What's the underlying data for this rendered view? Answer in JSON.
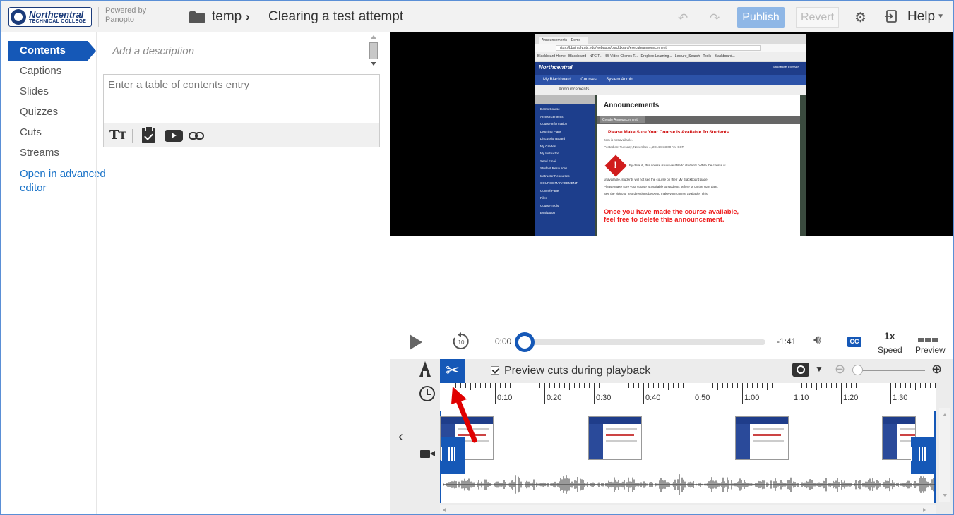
{
  "header": {
    "logo_name": "Northcentral",
    "logo_sub": "TECHNICAL COLLEGE",
    "powered_by": "Powered by Panopto",
    "breadcrumb_folder": "temp",
    "breadcrumb_title": "Clearing a test attempt",
    "publish_label": "Publish",
    "revert_label": "Revert",
    "help_label": "Help"
  },
  "sidebar": {
    "items": [
      {
        "label": "Contents",
        "active": true
      },
      {
        "label": "Captions"
      },
      {
        "label": "Slides"
      },
      {
        "label": "Quizzes"
      },
      {
        "label": "Cuts"
      },
      {
        "label": "Streams"
      }
    ],
    "advanced_link": "Open in advanced editor"
  },
  "contents": {
    "description_placeholder": "Add a description",
    "toc_placeholder": "Enter a table of contents entry",
    "toolbar_icons": [
      "text-format-icon",
      "quiz-icon",
      "youtube-icon",
      "link-icon"
    ]
  },
  "video_frame": {
    "tab_title": "Announcements – Demo",
    "url": "https://bbsimply.ntc.edu/webapps/blackboard/execute/announcement",
    "bookmarks": "Blackboard Home · Blackboard - NTC T... · 55 Video Clienes T... · Dropbox Learning... · Lecture_Search · Tools - Blackboard...",
    "brand": "Northcentral",
    "user": "Jonathan Dufner",
    "nav": [
      "My Blackboard",
      "Courses",
      "System Admin"
    ],
    "breadcrumb": "Announcements",
    "side_items": [
      "Demo Course",
      "Announcements",
      "Course Information",
      "Learning Plans",
      "Discussion Board",
      "My Grades",
      "My Instructor",
      "Send Email",
      "Student Resources",
      "Instructor Resources",
      "COURSE MANAGEMENT",
      "Control Panel",
      "Files",
      "Course Tools",
      "Evaluation"
    ],
    "heading": "Announcements",
    "create_btn": "Create Announcement",
    "msg_title": "Please Make Sure Your Course is Available To Students",
    "msg_line1": "Item is not available.",
    "msg_line2": "Posted on: Tuesday, November 4, 2014 8:33:00 AM CST",
    "msg_line3": "By default, this course is unavailable to students. While the course is",
    "msg_line4": "unavailable, students will not see the course on their My Blackboard page.",
    "msg_line5": "Please make sure your course is available to students before or on the start date.",
    "msg_line6": "See the video or text directions below to make your course available. This",
    "msg_big": "Once you have made the course available, feel free to delete this announcement."
  },
  "player": {
    "current_time": "0:00",
    "remaining": "-1:41",
    "speed_value": "1x",
    "speed_label": "Speed",
    "preview_label": "Preview",
    "cc_label": "CC",
    "progress": 0
  },
  "editor": {
    "preview_cuts_label": "Preview cuts during playback",
    "preview_cuts_checked": true,
    "ruler_labels": [
      "0:10",
      "0:20",
      "0:30",
      "0:40",
      "0:50",
      "1:00",
      "1:10",
      "1:20",
      "1:30"
    ],
    "zoom_level": 0
  },
  "colors": {
    "accent": "#1558b7",
    "annotation_arrow": "#e00000"
  }
}
